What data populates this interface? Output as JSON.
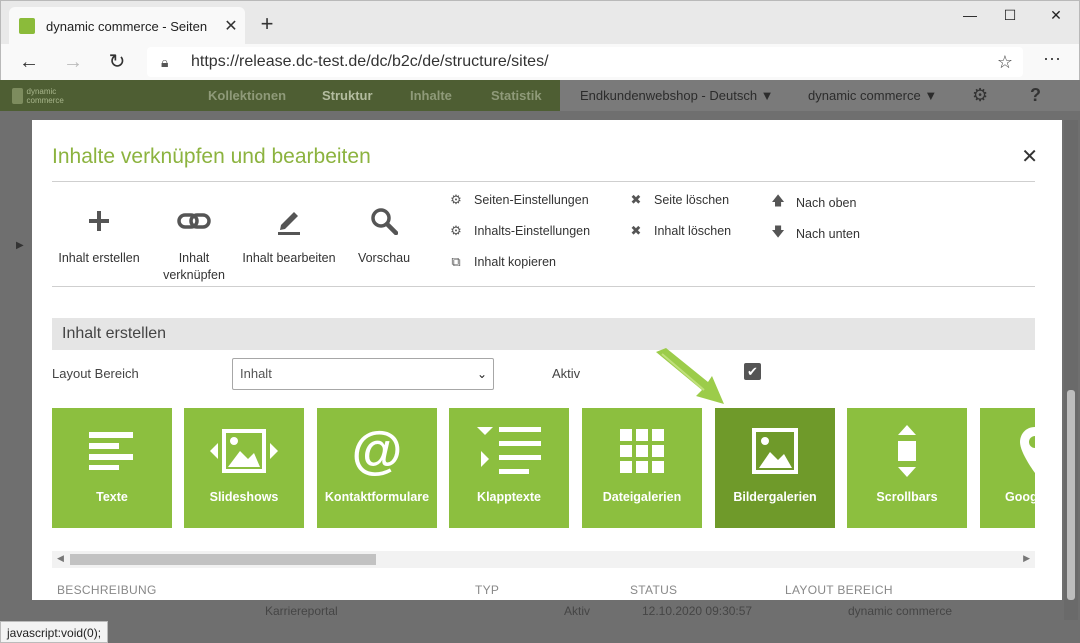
{
  "browser": {
    "tab_title": "dynamic commerce - Seiten",
    "tab_close": "✕",
    "new_tab": "+",
    "url": "https://release.dc-test.de/dc/b2c/de/structure/sites/",
    "status_text": "javascript:void(0);"
  },
  "app": {
    "logo_text": "dynamic commerce",
    "nav": [
      "Kollektionen",
      "Struktur",
      "Inhalte",
      "Statistik"
    ],
    "shop_select": "Endkundenwebshop - Deutsch",
    "tenant_select": "dynamic commerce",
    "help": "?",
    "bg_row": {
      "name": "Karriereportal",
      "status": "Aktiv",
      "date": "12.10.2020 09:30:57",
      "layout": "dynamic commerce"
    }
  },
  "modal": {
    "title": "Inhalte verknüpfen und bearbeiten",
    "close": "✕",
    "big_actions": [
      {
        "label": "Inhalt erstellen",
        "icon": "plus-icon"
      },
      {
        "label": "Inhalt verknüpfen",
        "icon": "link-icon"
      },
      {
        "label": "Inhalt bearbeiten",
        "icon": "pencil-icon"
      },
      {
        "label": "Vorschau",
        "icon": "search-icon"
      }
    ],
    "small_actions": {
      "col1": [
        "Seiten-Einstellungen",
        "Inhalts-Einstellungen",
        "Inhalt kopieren"
      ],
      "col2": [
        "Seite löschen",
        "Inhalt löschen"
      ],
      "col3": [
        "Nach oben",
        "Nach unten"
      ]
    },
    "section_title": "Inhalt erstellen",
    "form": {
      "layout_label": "Layout Bereich",
      "layout_value": "Inhalt",
      "active_label": "Aktiv",
      "active_checked": true
    },
    "tiles": [
      {
        "label": "Texte",
        "icon": "text-lines-icon"
      },
      {
        "label": "Slideshows",
        "icon": "slideshow-icon"
      },
      {
        "label": "Kontaktformulare",
        "icon": "at-icon"
      },
      {
        "label": "Klapptexte",
        "icon": "collapsible-text-icon"
      },
      {
        "label": "Dateigalerien",
        "icon": "grid-icon"
      },
      {
        "label": "Bildergalerien",
        "icon": "image-icon"
      },
      {
        "label": "Scrollbars",
        "icon": "vertical-scroll-icon"
      },
      {
        "label": "Goog",
        "icon": "map-pin-icon"
      }
    ],
    "columns": [
      "BESCHREIBUNG",
      "TYP",
      "STATUS",
      "LAYOUT BEREICH"
    ]
  },
  "colors": {
    "brand_green": "#8cbf3f",
    "active_tile": "#6f9a2a",
    "title_green": "#8cb33f"
  }
}
